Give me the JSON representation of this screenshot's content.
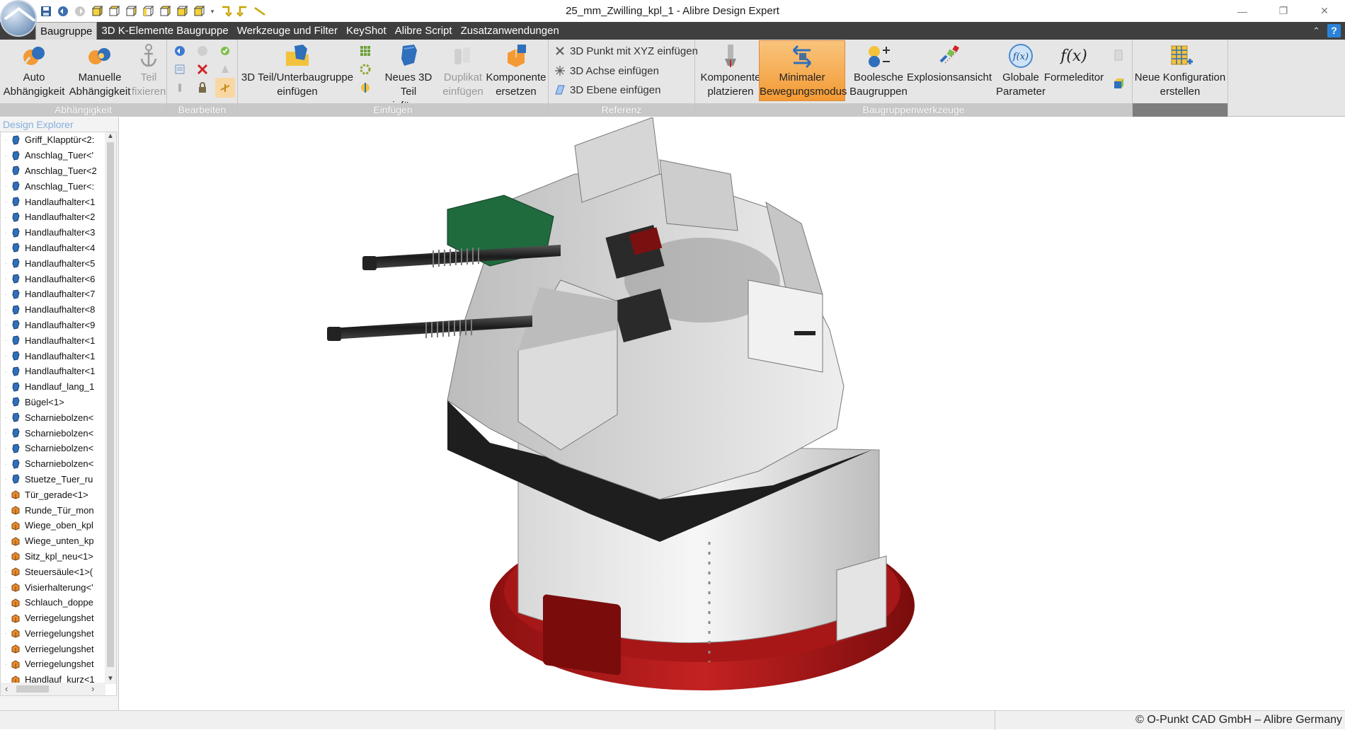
{
  "window": {
    "title": "25_mm_Zwilling_kpl_1 - Alibre Design Expert",
    "minimize": "—",
    "restore": "❐",
    "close": "✕"
  },
  "menu": {
    "tabs": [
      "Baugruppe",
      "3D K-Elemente Baugruppe",
      "Werkzeuge und Filter",
      "KeyShot",
      "Alibre Script",
      "Zusatzanwendungen"
    ],
    "active_tab": "Baugruppe",
    "collapse": "⌃",
    "help": "?"
  },
  "ribbon": {
    "groups": {
      "abhaengigkeit": "Abhängigkeit",
      "bearbeiten": "Bearbeiten",
      "einfuegen": "Einfügen",
      "referenz": "Referenz",
      "baugruppenwerkzeuge": "Baugruppenwerkzeuge"
    },
    "buttons": {
      "auto_1": "Auto",
      "auto_2": "Abhängigkeit",
      "manuell_1": "Manuelle",
      "manuell_2": "Abhängigkeit",
      "teil_1": "Teil",
      "teil_2": "fixieren",
      "teil3d_1": "3D Teil/Unterbaugruppe",
      "teil3d_2": "einfügen",
      "neues_1": "Neues 3D Teil",
      "neues_2": "einfügen",
      "duplikat_1": "Duplikat",
      "duplikat_2": "einfügen",
      "komp_ersetzen_1": "Komponente",
      "komp_ersetzen_2": "ersetzen",
      "komp_platz_1": "Komponente",
      "komp_platz_2": "platzieren",
      "minimaler_1": "Minimaler",
      "minimaler_2": "Bewegungsmodus",
      "boolesche_1": "Boolesche",
      "boolesche_2": "Baugruppen",
      "explosion_1": "Explosionsansicht",
      "globale_1": "Globale",
      "globale_2": "Parameter",
      "formel_1": "Formeleditor",
      "neue_konf_1": "Neue Konfiguration",
      "neue_konf_2": "erstellen"
    },
    "referenz_items": [
      "3D Punkt mit XYZ einfügen",
      "3D Achse einfügen",
      "3D Ebene einfügen"
    ]
  },
  "explorer": {
    "title": "Design Explorer",
    "items": [
      "Griff_Klapptür<2:",
      "Anschlag_Tuer<'",
      "Anschlag_Tuer<2",
      "Anschlag_Tuer<:",
      "Handlaufhalter<1",
      "Handlaufhalter<2",
      "Handlaufhalter<3",
      "Handlaufhalter<4",
      "Handlaufhalter<5",
      "Handlaufhalter<6",
      "Handlaufhalter<7",
      "Handlaufhalter<8",
      "Handlaufhalter<9",
      "Handlaufhalter<1",
      "Handlaufhalter<1",
      "Handlaufhalter<1",
      "Handlauf_lang_1",
      "Bügel<1>",
      "Scharniebolzen<",
      "Scharniebolzen<",
      "Scharniebolzen<",
      "Scharniebolzen<",
      "Stuetze_Tuer_ru",
      "Tür_gerade<1>",
      "Runde_Tür_mon",
      "Wiege_oben_kpl",
      "Wiege_unten_kp",
      "Sitz_kpl_neu<1>",
      "Steuersäule<1>(",
      "Visierhalterung<'",
      "Schlauch_doppe",
      "Verriegelungshet",
      "Verriegelungshet",
      "Verriegelungshet",
      "Verriegelungshet",
      "Handlauf_kurz<1"
    ]
  },
  "status": {
    "copyright": "© O-Punkt CAD GmbH – Alibre Germany"
  }
}
